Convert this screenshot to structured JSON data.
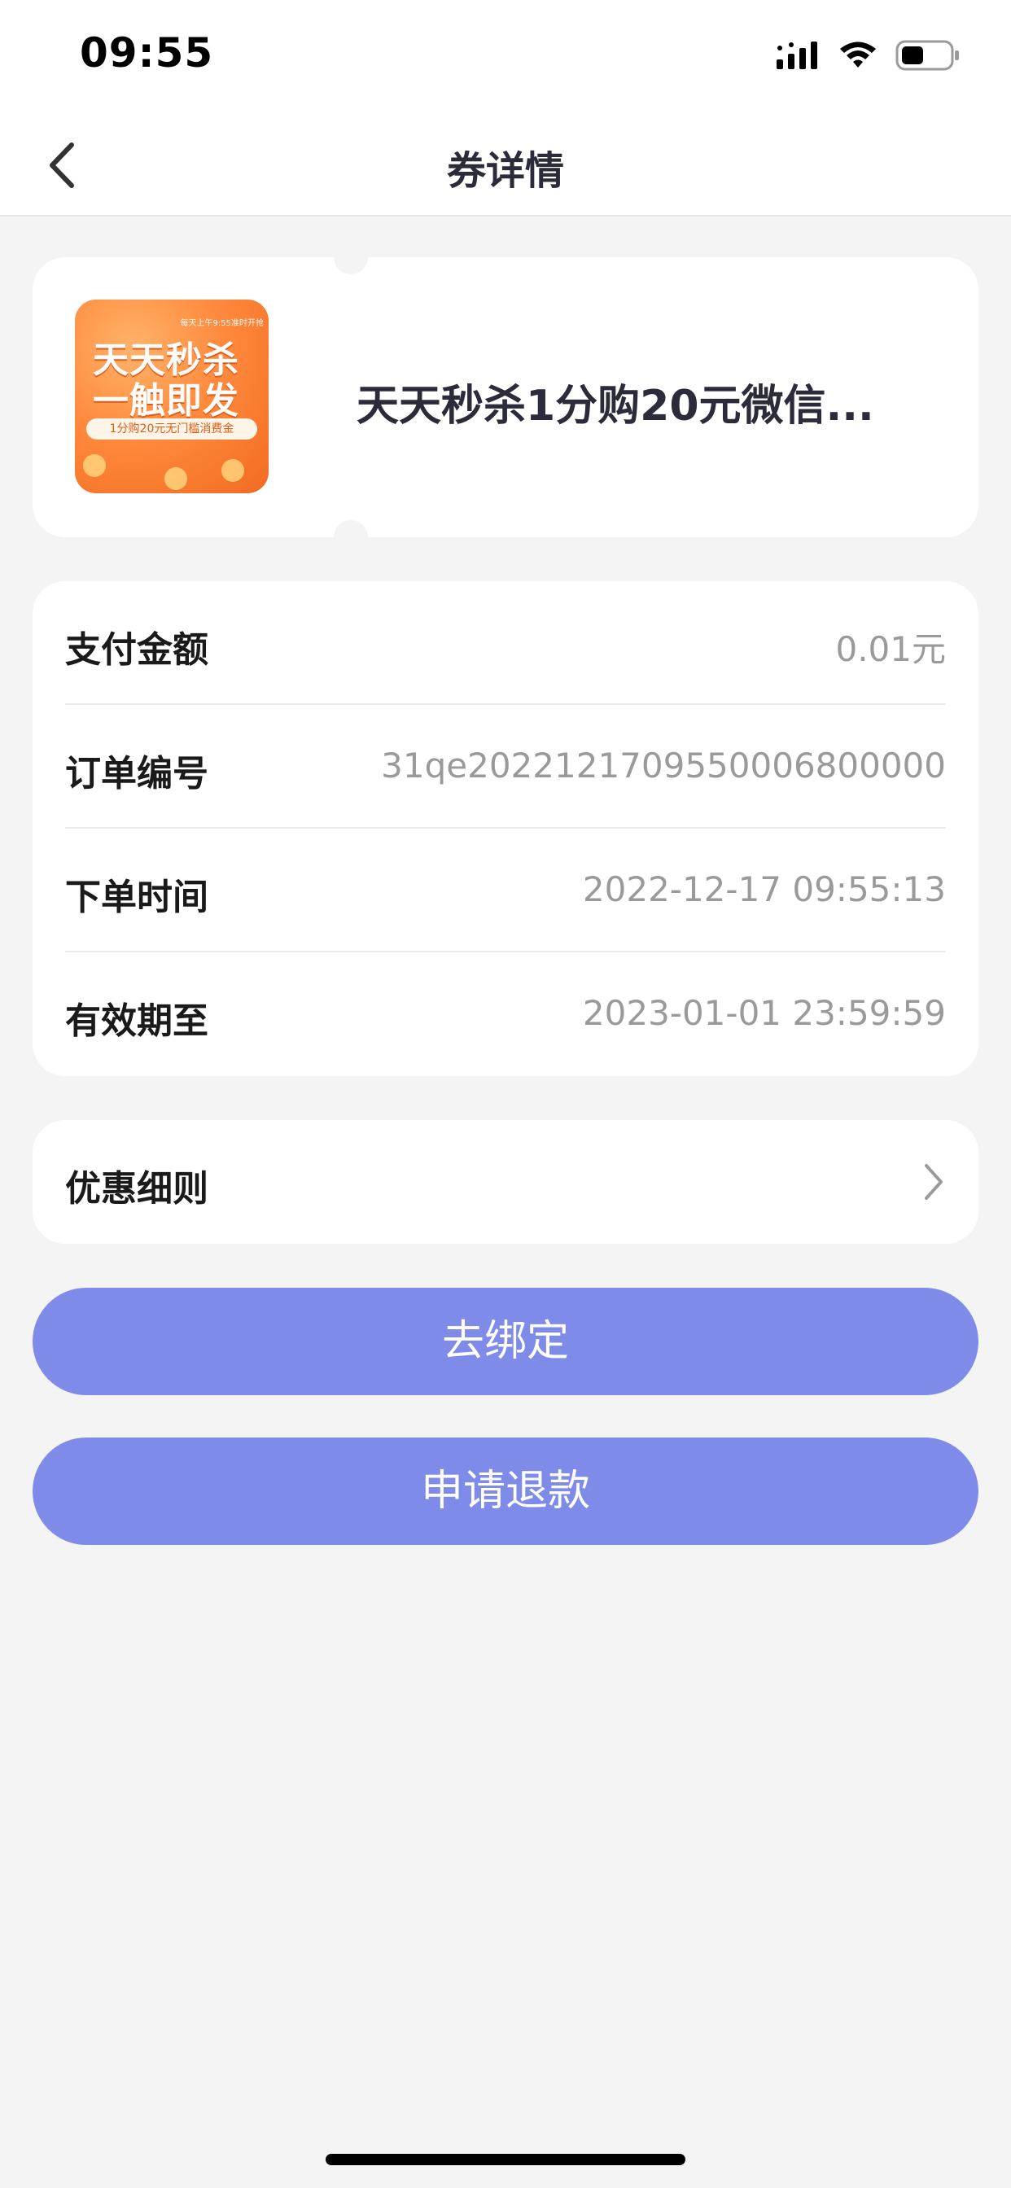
{
  "status_bar": {
    "time": "09:55"
  },
  "nav": {
    "title": "券详情"
  },
  "coupon": {
    "title": "天天秒杀1分购20元微信...",
    "thumbnail": {
      "top_text": "每天上午9:55准时开抢",
      "line1": "天天秒杀",
      "line2": "一触即发",
      "pill": "1分购20元无门槛消费金"
    }
  },
  "details": [
    {
      "label": "支付金额",
      "value": "0.01元"
    },
    {
      "label": "订单编号",
      "value": "31qe2022121709550006800000"
    },
    {
      "label": "下单时间",
      "value": "2022-12-17 09:55:13"
    },
    {
      "label": "有效期至",
      "value": "2023-01-01 23:59:59"
    }
  ],
  "rules": {
    "label": "优惠细则"
  },
  "buttons": {
    "bind": "去绑定",
    "refund": "申请退款"
  },
  "colors": {
    "accent": "#7f8be8",
    "background": "#f4f4f4"
  }
}
